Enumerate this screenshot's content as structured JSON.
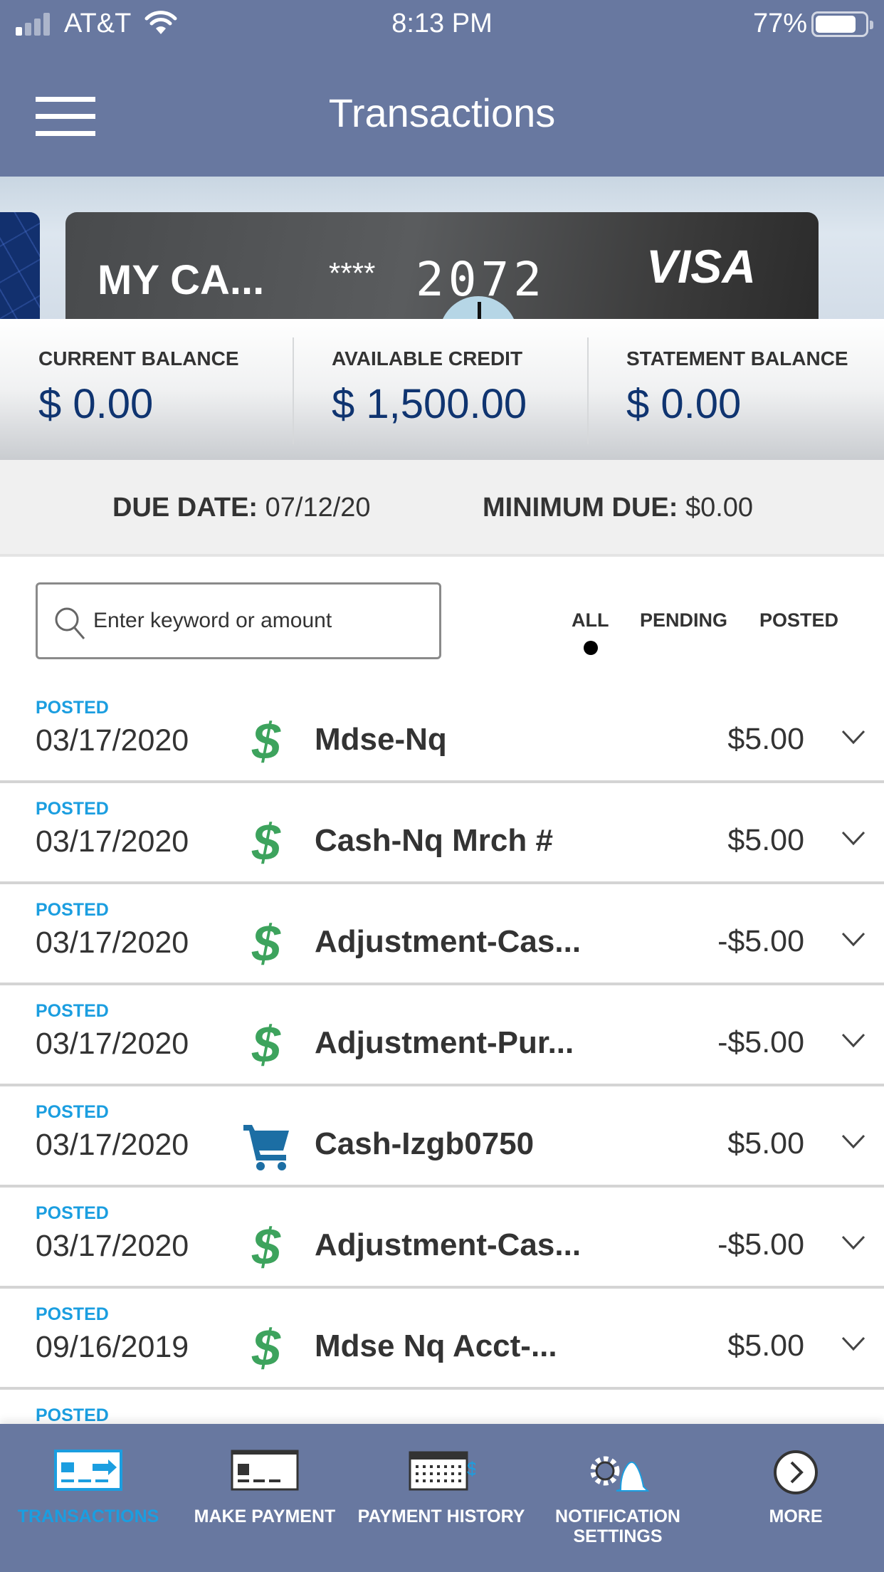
{
  "status_bar": {
    "carrier": "AT&T",
    "time": "8:13 PM",
    "battery_percent": "77%",
    "battery_level": 0.77,
    "signal_bars": 1
  },
  "header": {
    "title": "Transactions",
    "menu_icon": "hamburger-icon"
  },
  "card": {
    "name": "MY CA...",
    "masked": "****",
    "last4": "2072",
    "network": "VISA"
  },
  "balances": [
    {
      "label": "CURRENT BALANCE",
      "value": "$ 0.00"
    },
    {
      "label": "AVAILABLE CREDIT",
      "value": "$ 1,500.00"
    },
    {
      "label": "STATEMENT BALANCE",
      "value": "$ 0.00"
    }
  ],
  "due": {
    "due_date_label": "DUE DATE:",
    "due_date": "07/12/20",
    "minimum_due_label": "MINIMUM DUE:",
    "minimum_due": "$0.00"
  },
  "search": {
    "placeholder": "Enter keyword or amount",
    "value": ""
  },
  "filters": {
    "options": [
      "ALL",
      "PENDING",
      "POSTED"
    ],
    "selected": "ALL"
  },
  "colors": {
    "header_bg": "#6878a0",
    "accent_blue": "#1b9ee0",
    "balance_blue": "#0f3470",
    "dollar_green": "#3da35d",
    "cart_blue": "#1c6ea4"
  },
  "transactions": [
    {
      "status": "POSTED",
      "date": "03/17/2020",
      "icon": "dollar-icon",
      "description": "Mdse-Nq",
      "amount": "$5.00"
    },
    {
      "status": "POSTED",
      "date": "03/17/2020",
      "icon": "dollar-icon",
      "description": "Cash-Nq Mrch #",
      "amount": "$5.00"
    },
    {
      "status": "POSTED",
      "date": "03/17/2020",
      "icon": "dollar-icon",
      "description": "Adjustment-Cas...",
      "amount": "-$5.00"
    },
    {
      "status": "POSTED",
      "date": "03/17/2020",
      "icon": "dollar-icon",
      "description": "Adjustment-Pur...",
      "amount": "-$5.00"
    },
    {
      "status": "POSTED",
      "date": "03/17/2020",
      "icon": "cart-icon",
      "description": "Cash-Izgb0750",
      "amount": "$5.00"
    },
    {
      "status": "POSTED",
      "date": "03/17/2020",
      "icon": "dollar-icon",
      "description": "Adjustment-Cas...",
      "amount": "-$5.00"
    },
    {
      "status": "POSTED",
      "date": "09/16/2019",
      "icon": "dollar-icon",
      "description": "Mdse Nq Acct-...",
      "amount": "$5.00"
    },
    {
      "status": "POSTED"
    }
  ],
  "bottom_nav": [
    {
      "label": "TRANSACTIONS",
      "icon": "transactions-icon",
      "active": true
    },
    {
      "label": "MAKE PAYMENT",
      "icon": "make-payment-icon",
      "active": false
    },
    {
      "label": "PAYMENT HISTORY",
      "icon": "payment-history-icon",
      "active": false
    },
    {
      "label": "NOTIFICATION SETTINGS",
      "icon": "notification-settings-icon",
      "active": false
    },
    {
      "label": "MORE",
      "icon": "more-icon",
      "active": false
    }
  ]
}
